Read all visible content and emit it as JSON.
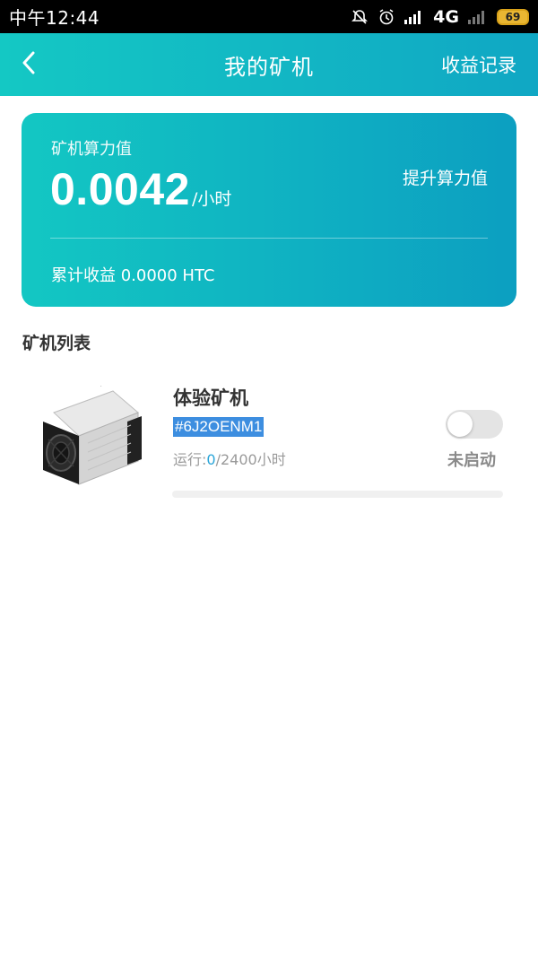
{
  "status_bar": {
    "time": "中午12:44",
    "network": "4G",
    "battery": "69"
  },
  "header": {
    "title": "我的矿机",
    "action_label": "收益记录"
  },
  "summary_card": {
    "hashrate_label": "矿机算力值",
    "hashrate_value": "0.0042",
    "hashrate_unit": "/小时",
    "boost_label": "提升算力值",
    "cumulative_label": "累计收益 0.0000 HTC"
  },
  "miner_list": {
    "title": "矿机列表",
    "items": [
      {
        "name": "体验矿机",
        "id": "#6J2OENM1",
        "run_prefix": "运行:",
        "run_current": "0",
        "run_total": "/2400小时",
        "status": "未启动",
        "enabled": false,
        "progress": 0
      }
    ]
  },
  "colors": {
    "accent": "#10a7c4",
    "accent_light": "#14c8c4",
    "highlight": "#2aa5d8"
  }
}
